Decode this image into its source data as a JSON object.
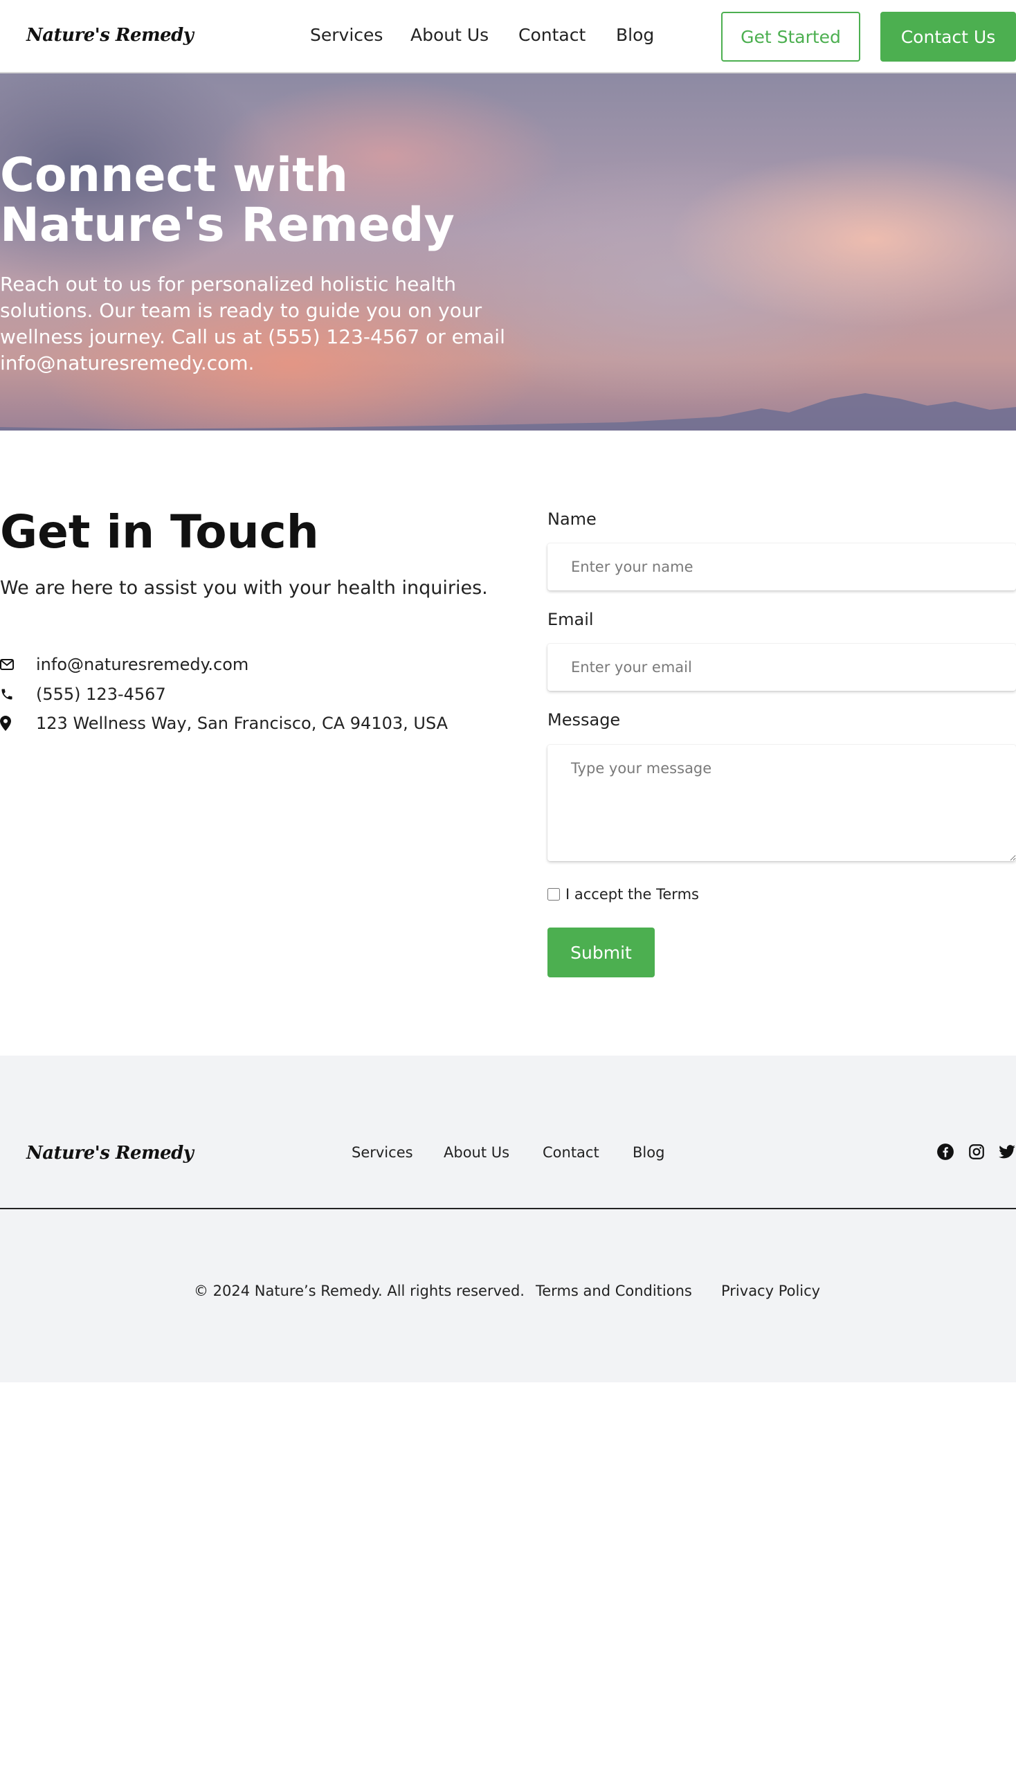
{
  "header": {
    "logo": "Nature's Remedy",
    "nav": [
      "Services",
      "About Us",
      "Contact",
      "Blog"
    ],
    "get_started": "Get Started",
    "contact_us": "Contact Us"
  },
  "hero": {
    "title": "Connect with Nature's Remedy",
    "text": "Reach out to us for personalized holistic health solutions. Our team is ready to guide you on your wellness journey. Call us at (555) 123-4567 or email info@naturesremedy.com."
  },
  "contact": {
    "title": "Get in Touch",
    "subtitle": "We are here to assist you with your health inquiries.",
    "email": "info@naturesremedy.com",
    "phone": "(555) 123-4567",
    "address": "123 Wellness Way, San Francisco, CA 94103, USA"
  },
  "form": {
    "name_label": "Name",
    "name_placeholder": "Enter your name",
    "email_label": "Email",
    "email_placeholder": "Enter your email",
    "message_label": "Message",
    "message_placeholder": "Type your message",
    "terms_label": "I accept the Terms",
    "submit": "Submit"
  },
  "footer": {
    "logo": "Nature's Remedy",
    "nav": [
      "Services",
      "About Us",
      "Contact",
      "Blog"
    ],
    "social_icons": [
      "facebook-icon",
      "instagram-icon",
      "twitter-icon"
    ],
    "copyright": "© 2024 Nature’s Remedy. All rights reserved.",
    "terms": "Terms and Conditions",
    "privacy": "Privacy Policy"
  },
  "colors": {
    "accent": "#4caf50",
    "footer_bg": "#f2f3f5"
  }
}
